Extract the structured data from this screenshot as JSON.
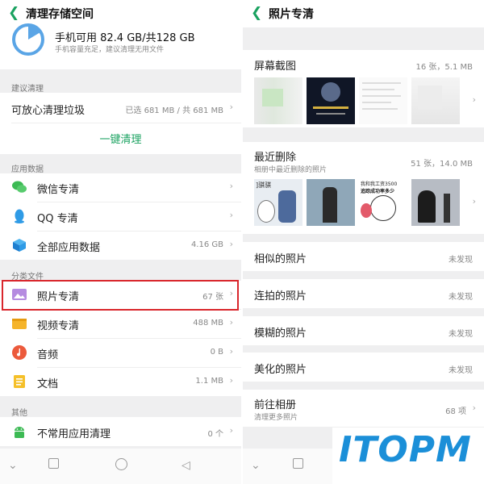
{
  "left": {
    "title": "清理存储空间",
    "storage": {
      "line1": "手机可用 82.4 GB/共128 GB",
      "line2": "手机容量充足，建议清理无用文件"
    },
    "suggest": {
      "section": "建议清理",
      "label": "可放心清理垃圾",
      "value": "已选 681 MB / 共 681 MB",
      "action": "一键清理"
    },
    "app_data": {
      "section": "应用数据",
      "items": [
        {
          "label": "微信专清",
          "value": ""
        },
        {
          "label": "QQ 专清",
          "value": ""
        },
        {
          "label": "全部应用数据",
          "value": "4.16 GB"
        }
      ]
    },
    "categories": {
      "section": "分类文件",
      "items": [
        {
          "label": "照片专清",
          "value": "67 张"
        },
        {
          "label": "视频专清",
          "value": "488 MB"
        },
        {
          "label": "音频",
          "value": "0 B"
        },
        {
          "label": "文档",
          "value": "1.1 MB"
        }
      ]
    },
    "other": {
      "section": "其他",
      "items": [
        {
          "label": "不常用应用清理",
          "value": "0 个"
        }
      ]
    }
  },
  "right": {
    "title": "照片专清",
    "screenshots": {
      "label": "屏幕截图",
      "value": "16 张，5.1 MB"
    },
    "recent": {
      "label": "最近删除",
      "sub": "相册中最近删除的照片",
      "value": "51 张，14.0 MB",
      "thumb_texts": [
        "]骐骐",
        "我和我工资3500",
        "追踪成功率多少"
      ]
    },
    "rows": [
      {
        "label": "相似的照片",
        "value": "未发现"
      },
      {
        "label": "连拍的照片",
        "value": "未发现"
      },
      {
        "label": "模糊的照片",
        "value": "未发现"
      },
      {
        "label": "美化的照片",
        "value": "未发现"
      }
    ],
    "album": {
      "label": "前往相册",
      "sub": "清理更多照片",
      "value": "68 项"
    }
  },
  "watermark": "ITOPM",
  "colors": {
    "accent": "#1aa260",
    "highlight_border": "#d9262c",
    "watermark_blue": "#1b8fd8",
    "background": "#efeff0"
  },
  "icons": {
    "back": "chevron-left-icon",
    "chevron": "chevron-right-icon",
    "storage": "pie-chart-icon",
    "wechat": "wechat-icon",
    "qq": "qq-penguin-icon",
    "all_apps": "cube-icon",
    "photos": "image-icon",
    "video": "video-icon",
    "audio": "music-icon",
    "docs": "document-icon",
    "android": "android-icon"
  }
}
